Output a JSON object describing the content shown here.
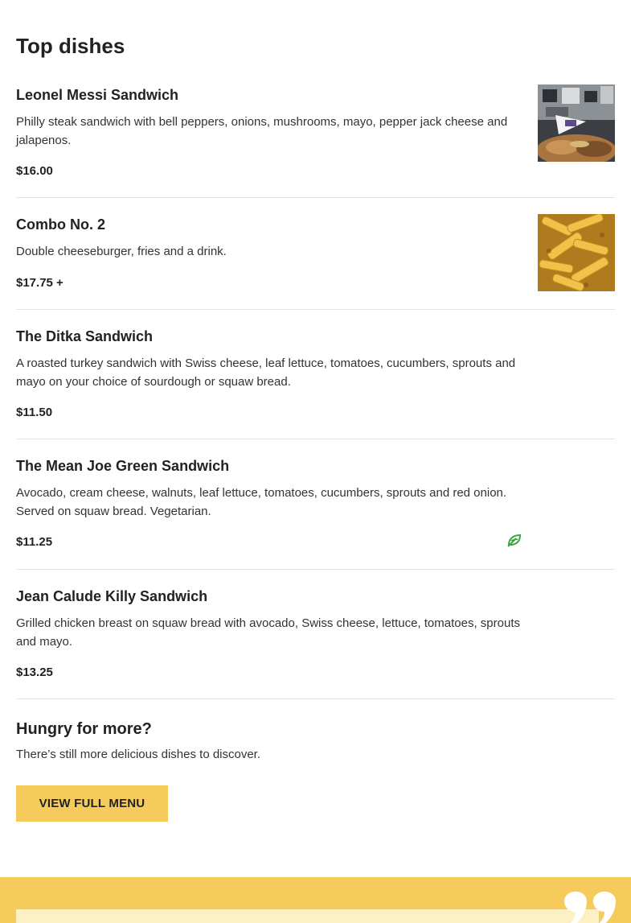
{
  "section": {
    "title": "Top dishes"
  },
  "dishes": [
    {
      "name": "Leonel Messi Sandwich",
      "description": "Philly steak sandwich with bell peppers, onions, mushrooms, mayo, pepper jack cheese and jalapenos.",
      "price": "$16.00",
      "thumbnail": "sandwich-photo",
      "vegetarian": false
    },
    {
      "name": "Combo No. 2",
      "description": "Double cheeseburger, fries and a drink.",
      "price": "$17.75 +",
      "thumbnail": "fries-photo",
      "vegetarian": false
    },
    {
      "name": "The Ditka Sandwich",
      "description": "A roasted turkey sandwich with Swiss cheese, leaf lettuce, tomatoes, cucumbers, sprouts and mayo on your choice of sourdough or squaw bread.",
      "price": "$11.50",
      "vegetarian": false
    },
    {
      "name": "The Mean Joe Green Sandwich",
      "description": "Avocado, cream cheese, walnuts, leaf lettuce, tomatoes, cucumbers, sprouts and red onion. Served on squaw bread. Vegetarian.",
      "price": "$11.25",
      "vegetarian": true,
      "icon": "leaf-icon"
    },
    {
      "name": "Jean Calude Killy Sandwich",
      "description": "Grilled chicken breast on squaw bread with avocado, Swiss cheese, lettuce, tomatoes, sprouts and mayo.",
      "price": "$13.25",
      "vegetarian": false
    }
  ],
  "more": {
    "title": "Hungry for more?",
    "text": "There’s still more delicious dishes to discover.",
    "button_label": "VIEW FULL MENU"
  },
  "colors": {
    "accent": "#f5cb5c",
    "card": "#fdf1c4",
    "vegetarian": "#3aa63a",
    "divider": "#e4e4e4"
  },
  "testimonial": {
    "icon": "quote-icon"
  }
}
